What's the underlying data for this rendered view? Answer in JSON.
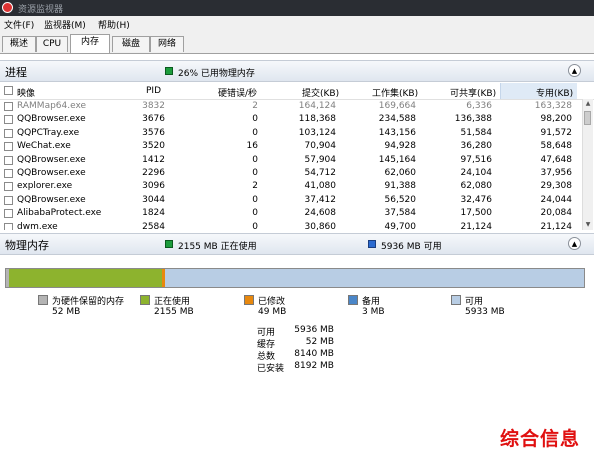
{
  "window": {
    "title": "资源监视器"
  },
  "menu": [
    "文件(F)",
    "监视器(M)",
    "帮助(H)"
  ],
  "tabs": [
    "概述",
    "CPU",
    "内存",
    "磁盘",
    "网络"
  ],
  "processes": {
    "title": "进程",
    "usage_text": "26% 已用物理内存",
    "columns": [
      "映像",
      "PID",
      "硬错误/秒",
      "提交(KB)",
      "工作集(KB)",
      "可共享(KB)",
      "专用(KB)"
    ],
    "rows": [
      [
        "RAMMap64.exe",
        "3832",
        "2",
        "164,124",
        "169,664",
        "6,336",
        "163,328"
      ],
      [
        "QQBrowser.exe",
        "3676",
        "0",
        "118,368",
        "234,588",
        "136,388",
        "98,200"
      ],
      [
        "QQPCTray.exe",
        "3576",
        "0",
        "103,124",
        "143,156",
        "51,584",
        "91,572"
      ],
      [
        "WeChat.exe",
        "3520",
        "16",
        "70,904",
        "94,928",
        "36,280",
        "58,648"
      ],
      [
        "QQBrowser.exe",
        "1412",
        "0",
        "57,904",
        "145,164",
        "97,516",
        "47,648"
      ],
      [
        "QQBrowser.exe",
        "2296",
        "0",
        "54,712",
        "62,060",
        "24,104",
        "37,956"
      ],
      [
        "explorer.exe",
        "3096",
        "2",
        "41,080",
        "91,388",
        "62,080",
        "29,308"
      ],
      [
        "QQBrowser.exe",
        "3044",
        "0",
        "37,412",
        "56,520",
        "32,476",
        "24,044"
      ],
      [
        "AlibabaProtect.exe",
        "1824",
        "0",
        "24,608",
        "37,584",
        "17,500",
        "20,084"
      ],
      [
        "dwm.exe",
        "2584",
        "0",
        "30,860",
        "49,700",
        "21,124",
        "21,124"
      ]
    ]
  },
  "physical_memory": {
    "title": "物理内存",
    "in_use_text": "2155 MB 正在使用",
    "available_text": "5936 MB 可用",
    "legend": [
      {
        "label": "为硬件保留的内存",
        "value": "52 MB",
        "color": "#b4b4b4"
      },
      {
        "label": "正在使用",
        "value": "2155 MB",
        "color": "#8db32e"
      },
      {
        "label": "已修改",
        "value": "49 MB",
        "color": "#e8880e"
      },
      {
        "label": "备用",
        "value": "3 MB",
        "color": "#4a86c8"
      },
      {
        "label": "可用",
        "value": "5933 MB",
        "color": "#b8cde4"
      }
    ],
    "bar_fractions": [
      0.006,
      0.2631,
      0.006,
      0.0004,
      0.7245
    ],
    "stats": [
      {
        "label": "可用",
        "value": "5936 MB"
      },
      {
        "label": "缓存",
        "value": "52 MB"
      },
      {
        "label": "总数",
        "value": "8140 MB"
      },
      {
        "label": "已安装",
        "value": "8192 MB"
      }
    ]
  },
  "watermark": "综合信息"
}
